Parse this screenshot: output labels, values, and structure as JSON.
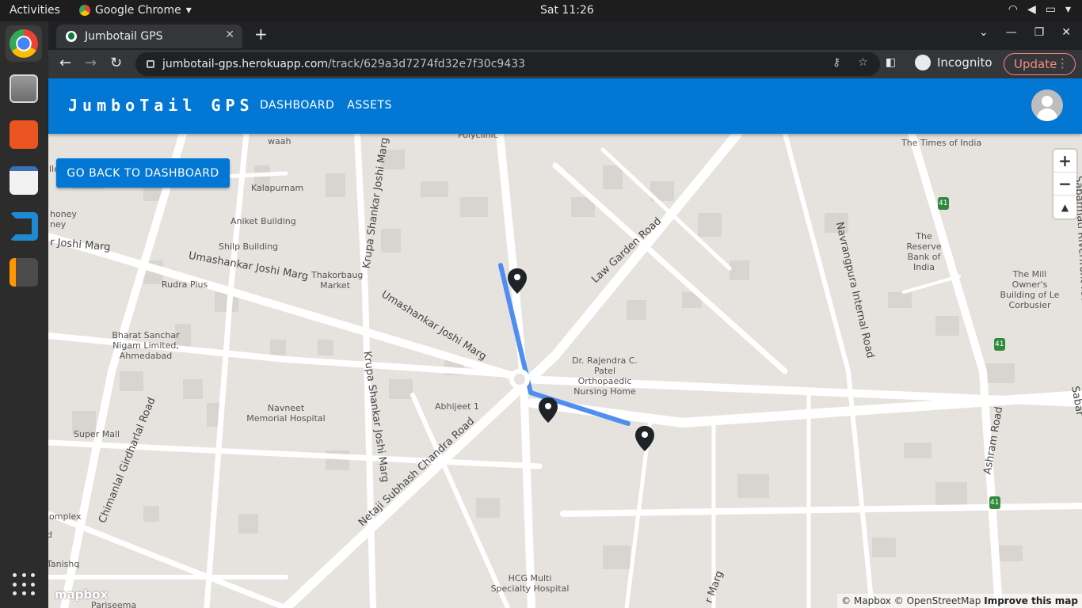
{
  "system": {
    "activities": "Activities",
    "app_name": "Google Chrome",
    "clock": "Sat 11:26"
  },
  "browser": {
    "tab_title": "Jumbotail GPS",
    "url_host": "jumbotail-gps.herokuapp.com",
    "url_path": "/track/629a3d7274fd32e7f30c9433",
    "incognito_label": "Incognito",
    "update_label": "Update"
  },
  "app": {
    "brand": "JumboTail GPS",
    "nav": {
      "dashboard": "DASHBOARD",
      "assets": "ASSETS"
    },
    "back_button": "GO BACK TO DASHBOARD"
  },
  "map": {
    "labels": {
      "waah": "waah",
      "polyclinic": "Polyclinic",
      "kalapurnam": "Kalapurnam",
      "aniket": "Aniket Building",
      "shilp": "Shilp Building",
      "honey": "honey",
      "honey2": "ney",
      "rudra": "Rudra Plus",
      "thakorbaug": "Thakorbaug Market",
      "bsnl": "Bharat Sanchar Nigam Limited, Ahmedabad",
      "navneet": "Navneet Memorial Hospital",
      "abhijeet": "Abhijeet 1",
      "supermall": "Super Mall",
      "rajendra": "Dr. Rajendra C. Patel Orthopaedic Nursing Home",
      "times": "The Times of India",
      "rbi": "The Reserve Bank of India",
      "millowner": "The Mill Owner's Building of Le Corbusier",
      "hcg": "HCG Multi Specialty Hospital",
      "complex": "omplex",
      "tanishq": "Tanishq",
      "pariseema": "Pariseema",
      "lle": "lle",
      "d": "d"
    },
    "roads": {
      "joshi_left": "r Joshi Marg",
      "umashankar1": "Umashankar Joshi Marg",
      "umashankar2": "Umashankar Joshi Marg",
      "krupa1": "Krupa Shankar Joshi Marg",
      "krupa2": "Krupa Shankar Joshi Marg",
      "lawgarden": "Law Garden Road",
      "navrangpura": "Navrangpura Internal Road",
      "sabarmati": "Sabarmati Riverfront road",
      "ashram": "Ashram Road",
      "netaji": "Netaji Subhash Chandra Road",
      "chimanlal": "Chimanlal Girdharlal Road",
      "marg_bottom": "r Marg",
      "sabar_edge": "Sabar"
    },
    "shields": [
      "41",
      "41",
      "41"
    ],
    "zoom_in": "+",
    "zoom_out": "−",
    "compass": "▲",
    "attribution_mapbox": "© Mapbox",
    "attribution_osm": "© OpenStreetMap",
    "improve": "Improve this map",
    "logo": "mapbox",
    "route_color": "#4f8ef0"
  }
}
